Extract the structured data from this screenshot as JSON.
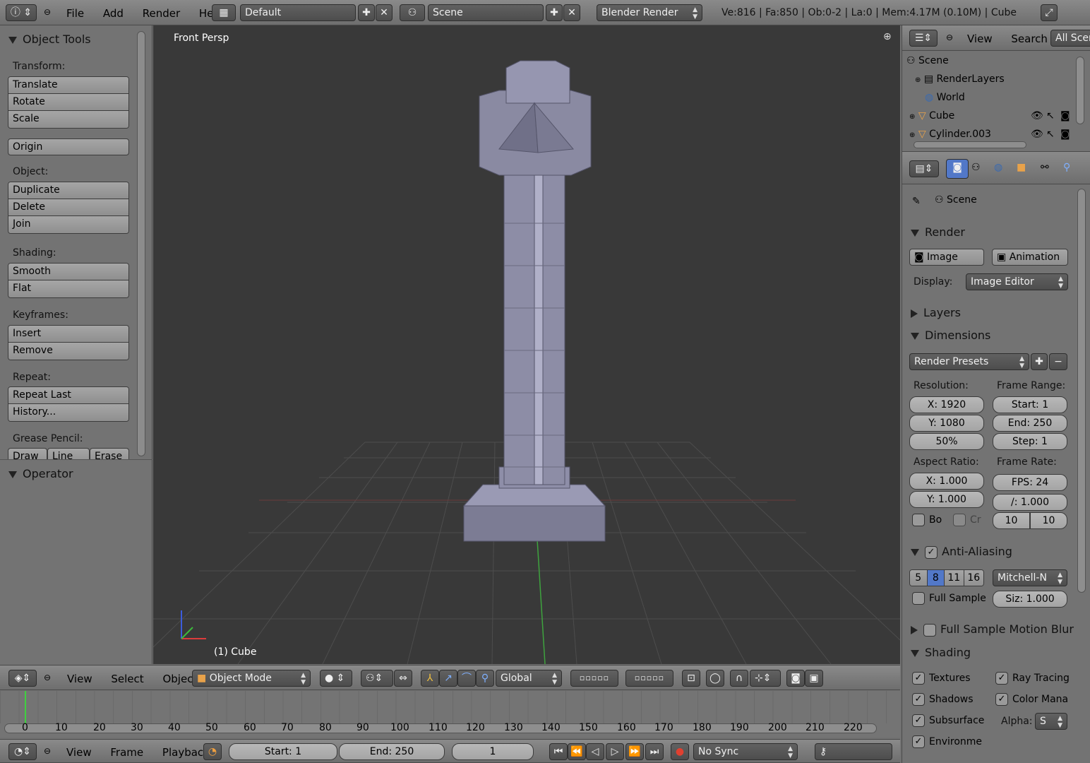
{
  "topbar": {
    "info_icon": "info-icon",
    "menus": [
      "File",
      "Add",
      "Render",
      "Help"
    ],
    "layout": "Default",
    "scene": "Scene",
    "engine": "Blender Render",
    "stats": "Ve:816 | Fa:850 | Ob:0-2 | La:0 | Mem:4.17M (0.10M) | Cube"
  },
  "tools": {
    "title": "Object Tools",
    "transform_label": "Transform:",
    "translate": "Translate",
    "rotate": "Rotate",
    "scale": "Scale",
    "origin": "Origin",
    "object_label": "Object:",
    "duplicate": "Duplicate",
    "delete": "Delete",
    "join": "Join",
    "shading_label": "Shading:",
    "smooth": "Smooth",
    "flat": "Flat",
    "keyframes_label": "Keyframes:",
    "insert": "Insert",
    "remove": "Remove",
    "repeat_label": "Repeat:",
    "repeat_last": "Repeat Last",
    "history": "History...",
    "grease_label": "Grease Pencil:",
    "draw": "Draw",
    "line": "Line",
    "erase": "Erase",
    "operator": "Operator"
  },
  "viewport": {
    "label": "Front Persp",
    "object_label": "(1) Cube"
  },
  "vp_header": {
    "menus": [
      "View",
      "Select",
      "Object"
    ],
    "mode": "Object Mode",
    "orientation": "Global"
  },
  "outliner": {
    "menus": [
      "View",
      "Search"
    ],
    "filter": "All Scen",
    "items": [
      "Scene",
      "RenderLayers",
      "World",
      "Cube",
      "Cylinder.003"
    ]
  },
  "properties": {
    "scene": "Scene",
    "render_title": "Render",
    "image_btn": "Image",
    "animation_btn": "Animation",
    "display_label": "Display:",
    "display_value": "Image Editor",
    "layers": "Layers",
    "dimensions": "Dimensions",
    "render_presets": "Render Presets",
    "resolution_label": "Resolution:",
    "res_x": "X: 1920",
    "res_y": "Y: 1080",
    "res_pct": "50%",
    "frame_range_label": "Frame Range:",
    "start": "Start: 1",
    "end": "End: 250",
    "step": "Step: 1",
    "aspect_label": "Aspect Ratio:",
    "asp_x": "X: 1.000",
    "asp_y": "Y: 1.000",
    "frame_rate_label": "Frame Rate:",
    "fps": "FPS: 24",
    "fps_base": "/: 1.000",
    "bo": "Bo",
    "cr": "Cr",
    "tr_a": "10",
    "tr_b": "10",
    "aa": "Anti-Aliasing",
    "aa_samples": [
      "5",
      "8",
      "11",
      "16"
    ],
    "filter": "Mitchell-N",
    "full_sample": "Full Sample",
    "siz": "Siz: 1.000",
    "motion_blur": "Full Sample Motion Blur",
    "shading": "Shading",
    "textures": "Textures",
    "ray_tracing": "Ray Tracing",
    "shadows": "Shadows",
    "color_mana": "Color Mana",
    "subsurface": "Subsurface",
    "alpha_label": "Alpha:",
    "alpha_value": "S",
    "environment": "Environme"
  },
  "timeline": {
    "ticks": [
      "0",
      "10",
      "20",
      "30",
      "40",
      "50",
      "60",
      "70",
      "80",
      "90",
      "100",
      "110",
      "120",
      "130",
      "140",
      "150",
      "160",
      "170",
      "180",
      "190",
      "200",
      "210",
      "220"
    ],
    "menus": [
      "View",
      "Frame",
      "Playback"
    ],
    "start": "Start: 1",
    "end": "End: 250",
    "current": "1",
    "sync": "No Sync"
  }
}
